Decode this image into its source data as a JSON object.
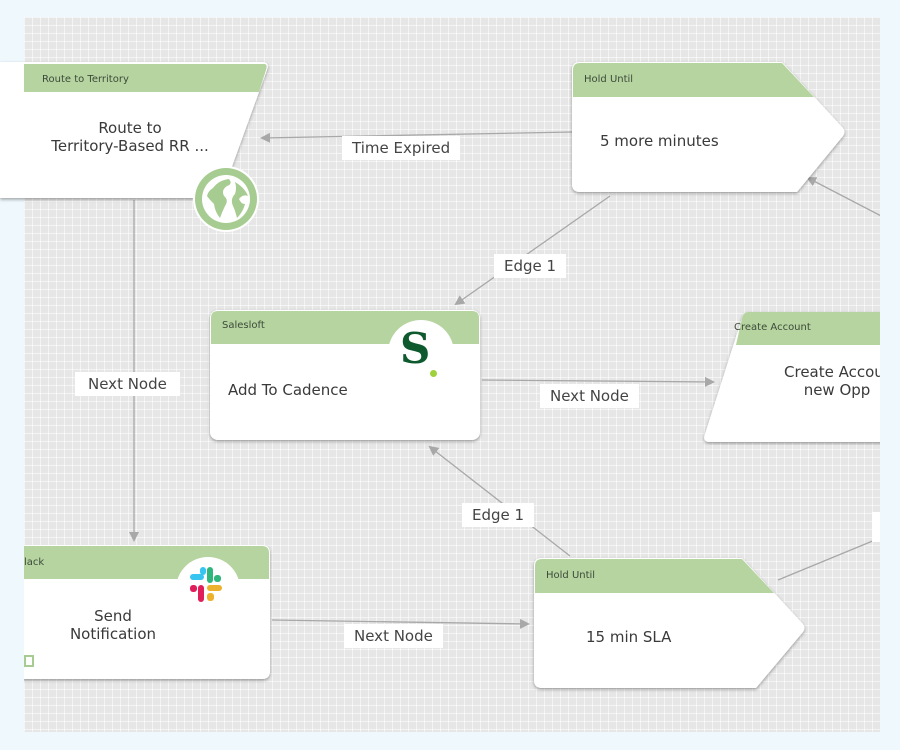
{
  "nodes": {
    "route_to_territory": {
      "header": "Route to Territory",
      "body": "Route to\nTerritory-Based RR ...",
      "icon": "globe-icon"
    },
    "hold_until_top": {
      "header": "Hold Until",
      "body": "5 more minutes"
    },
    "salesloft": {
      "header": "Salesloft",
      "body": "Add To Cadence",
      "icon": "salesloft-logo-icon",
      "icon_text": "S"
    },
    "create_account": {
      "header": "Create Account",
      "body": "Create Accour\nnew Opp"
    },
    "slack": {
      "header": "lack",
      "body": "Send\nNotification",
      "icon": "slack-logo-icon"
    },
    "hold_until_bottom": {
      "header": "Hold Until",
      "body": "15 min SLA"
    }
  },
  "edges": {
    "time_expired": "Time Expired",
    "edge1_top": "Edge 1",
    "next_node_left": "Next Node",
    "next_node_middle": "Next Node",
    "edge1_bottom": "Edge 1",
    "next_node_bottom": "Next Node"
  },
  "colors": {
    "header_green": "#b6d4a0",
    "globe_green": "#a7cc91",
    "salesloft_green": "#0e5a2e",
    "salesloft_dot": "#9fd13c",
    "canvas_bg": "#e6e6e6",
    "page_bg": "#eef8fd",
    "edge_gray": "#a8a8a8"
  }
}
